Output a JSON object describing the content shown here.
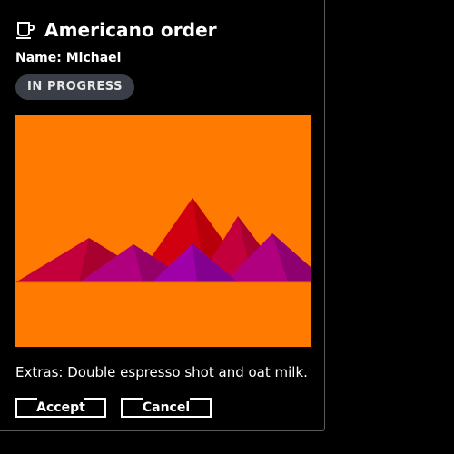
{
  "order": {
    "title": "Americano order",
    "name_line": "Name: Michael",
    "status": "IN PROGRESS",
    "extras": "Extras: Double espresso shot and oat milk.",
    "icon": "coffee-cup-icon"
  },
  "actions": {
    "accept_label": "Accept",
    "cancel_label": "Cancel"
  },
  "colors": {
    "background": "#000000",
    "badge": "#3a3f47",
    "image_sky": "#ff7a00",
    "mountain_red": "#d10010",
    "mountain_crimson": "#c4003c",
    "mountain_magenta": "#b00080",
    "mountain_purple": "#a000a8"
  }
}
